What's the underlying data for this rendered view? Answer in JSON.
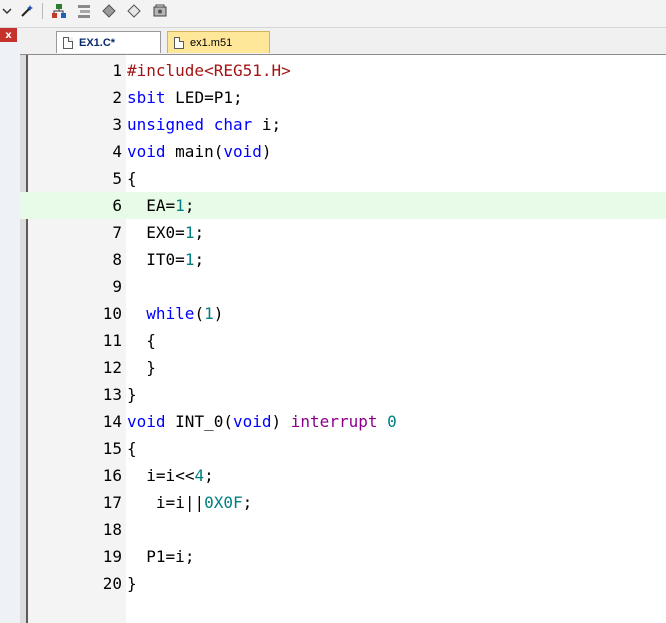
{
  "toolbar": {
    "icons": [
      "chevron-down-icon",
      "magic-wand-icon",
      "component-tree-icon",
      "stack-icon",
      "diamond-icon",
      "diamond-outline-icon",
      "books-icon"
    ]
  },
  "left_panel": {
    "close_label": "x"
  },
  "tabs": [
    {
      "label": "EX1.C*",
      "active": true
    },
    {
      "label": "ex1.m51",
      "active": false
    }
  ],
  "editor": {
    "current_line": 6,
    "lines": [
      {
        "num": "1",
        "code": "#include<REG51.H>"
      },
      {
        "num": "2",
        "code": "sbit LED=P1;"
      },
      {
        "num": "3",
        "code": "unsigned char i;"
      },
      {
        "num": "4",
        "code": "void main(void)"
      },
      {
        "num": "5",
        "code": "{"
      },
      {
        "num": "6",
        "code": "  EA=1;"
      },
      {
        "num": "7",
        "code": "  EX0=1;"
      },
      {
        "num": "8",
        "code": "  IT0=1;"
      },
      {
        "num": "9",
        "code": ""
      },
      {
        "num": "10",
        "code": "  while(1)"
      },
      {
        "num": "11",
        "code": "  {"
      },
      {
        "num": "12",
        "code": "  }"
      },
      {
        "num": "13",
        "code": "}"
      },
      {
        "num": "14",
        "code": "void INT_0(void) interrupt 0"
      },
      {
        "num": "15",
        "code": "{"
      },
      {
        "num": "16",
        "code": "  i=i<<4;"
      },
      {
        "num": "17",
        "code": "   i=i||0X0F;"
      },
      {
        "num": "18",
        "code": ""
      },
      {
        "num": "19",
        "code": "  P1=i;"
      },
      {
        "num": "20",
        "code": "}"
      }
    ]
  }
}
